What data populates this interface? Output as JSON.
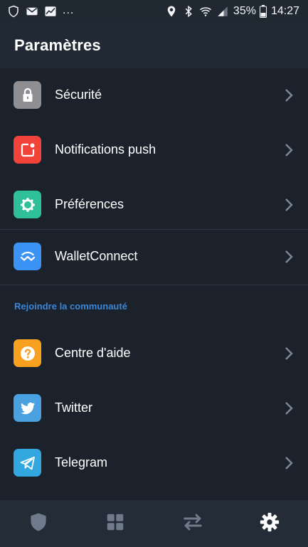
{
  "status_bar": {
    "battery": "35%",
    "time": "14:27",
    "more_indicator": "...",
    "left_icons": [
      "shield-icon",
      "mail-icon",
      "chart-icon"
    ],
    "right_icons": [
      "location-icon",
      "bluetooth-icon",
      "wifi-icon",
      "signal-icon",
      "battery-icon"
    ]
  },
  "header": {
    "title": "Paramètres"
  },
  "settings": {
    "items": [
      {
        "label": "Sécurité",
        "icon": "lock-icon",
        "icon_color": "#8e8e93"
      },
      {
        "label": "Notifications push",
        "icon": "notification-icon",
        "icon_color": "#f2433a"
      },
      {
        "label": "Préférences",
        "icon": "gear-icon",
        "icon_color": "#2fbf9a"
      },
      {
        "label": "WalletConnect",
        "icon": "walletconnect-icon",
        "icon_color": "#3b93f5"
      }
    ],
    "community_header": "Rejoindre la communauté",
    "community_items": [
      {
        "label": "Centre d'aide",
        "icon": "help-icon",
        "icon_color": "#f8a020"
      },
      {
        "label": "Twitter",
        "icon": "twitter-icon",
        "icon_color": "#4aa1e0"
      },
      {
        "label": "Telegram",
        "icon": "telegram-icon",
        "icon_color": "#33a8e0"
      }
    ]
  },
  "bottom_nav": {
    "items": [
      {
        "icon": "shield-icon",
        "active": false
      },
      {
        "icon": "dashboard-icon",
        "active": false
      },
      {
        "icon": "swap-icon",
        "active": false
      },
      {
        "icon": "settings-icon",
        "active": true
      }
    ],
    "active_color": "#ffffff",
    "inactive_color": "#6f7b8a"
  },
  "colors": {
    "background": "#1c222b",
    "header_bg": "#212a34",
    "accent": "#3a86d6",
    "divider": "#2e3743"
  }
}
